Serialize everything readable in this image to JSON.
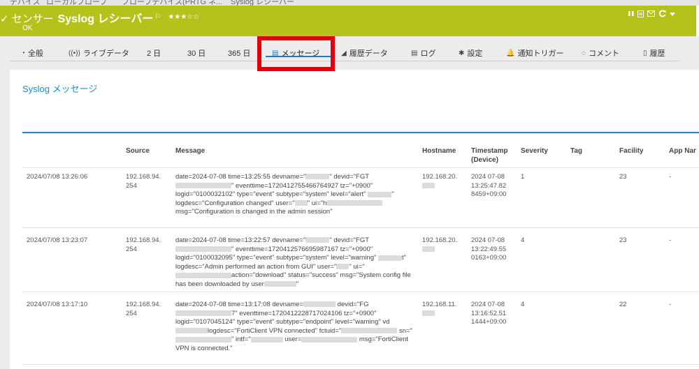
{
  "breadcrumb": [
    "デバイス",
    "ローカルプローブ",
    "プローブデバイス(PRTG ネ...",
    "Syslog レシーバー"
  ],
  "header": {
    "check": "✓",
    "type_label": "センサー",
    "sensor_name": "Syslog レシーバー",
    "flag_icon": "⚐",
    "stars": "★★★☆☆",
    "status": "OK",
    "tools": [
      "pause-icon",
      "report-icon",
      "mail-icon",
      "refresh-icon",
      "dropdown-icon"
    ]
  },
  "tabs": [
    {
      "icon": "◔",
      "label": "全般"
    },
    {
      "icon": "((•))",
      "label": "ライブデータ"
    },
    {
      "icon": "",
      "label": "2 日"
    },
    {
      "icon": "",
      "label": "30 日"
    },
    {
      "icon": "",
      "label": "365 日"
    },
    {
      "icon": "▤",
      "label": "メッセージ"
    },
    {
      "icon": "◢",
      "label": "履歴データ"
    },
    {
      "icon": "▤",
      "label": "ログ"
    },
    {
      "icon": "✱",
      "label": "設定"
    },
    {
      "icon": "🔔",
      "label": "通知トリガー"
    },
    {
      "icon": "◌",
      "label": "コメント"
    },
    {
      "icon": "▯",
      "label": "履歴"
    }
  ],
  "panel": {
    "title": "Syslog メッセージ",
    "columns": [
      "Source",
      "Message",
      "Hostname",
      "Timestamp\n(Device)",
      "Severity",
      "Tag",
      "Facility",
      "App Nar"
    ]
  },
  "rows": [
    {
      "time": "2024/07/08 13:26:06",
      "source": "192.168.94.\n254",
      "msg_a": "date=2024-07-08 time=13:25:55 devname=\"",
      "msg_b": "\" devid=\"FGT",
      "msg_c": "\" eventtime=1720412755466764927 tz=\"+0900\" logid=\"0100032102\" type=\"event\" subtype=\"system\" level=\"alert\" ",
      "msg_d": "\" logdesc=\"Configuration changed\" user=\"",
      "msg_e": "\" ui=\"h",
      "msg_f": "msg=\"Configuration is changed in the admin session\"",
      "hostname": "192.168.20.",
      "timestamp": "2024 07-08\n13:25:47.82\n8459+09:00",
      "severity": "1",
      "tag": "",
      "facility": "23",
      "app": "-"
    },
    {
      "time": "2024/07/08 13:23:07",
      "source": "192.168.94.\n254",
      "msg_a": "date=2024-07-08 time=13:22:57 devname=\"",
      "msg_b": "\" devid=\"FGT",
      "msg_c": "\" eventtime=1720412576695987167 tz=\"+0900\" logid=\"0100032095\" type=\"event\" subtype=\"system\" level=\"warning\" ",
      "msg_d": "t\" logdesc=\"Admin performed an action from GUI\" user=\"",
      "msg_e": "\" ui=\"",
      "msg_f": "action=\"download\" status=\"success\" msg=\"System config file has been downloaded by user",
      "hostname": "192.168.20.",
      "timestamp": "2024 07-08\n13:22:49.55\n0163+09:00",
      "severity": "4",
      "tag": "",
      "facility": "23",
      "app": "-"
    },
    {
      "time": "2024/07/08 13:17:10",
      "source": "192.168.94.\n254",
      "msg_a": "date=2024-07-08 time=13:17:08 devname=",
      "msg_b": " devid=\"FG",
      "msg_c": "7\" eventtime=1720412228717024106 tz=\"+0900\" logid=\"0107045124\" type=\"event\" subtype=\"endpoint\" level=\"warning\" vd",
      "msg_d": "logdesc=\"FortiClient VPN connected\" fctuid=\"",
      "msg_e": " sn=\"",
      "msg_f": "\" intf=\"",
      "msg_g": " user=",
      "msg_h": " msg=\"FortiClient VPN is connected.\"",
      "hostname": "192.168.11.",
      "timestamp": "2024 07-08\n13:16:52.51\n1444+09:00",
      "severity": "4",
      "tag": "",
      "facility": "22",
      "app": "-"
    }
  ],
  "colors": {
    "header": "#b5c21c",
    "accent": "#1c8cc9",
    "highlight": "#e1000f"
  }
}
